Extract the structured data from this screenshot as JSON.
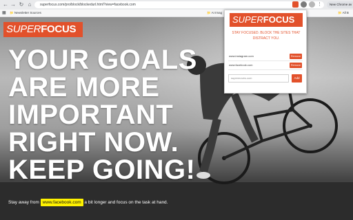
{
  "browser": {
    "url": "superfocus.com/pro/block/blockedurl.html?view=facebook.com",
    "new_chrome_label": "New Chrome av",
    "bookmarks": [
      "Newsletter Sources",
      "AI Imag",
      "All B"
    ]
  },
  "page": {
    "logo_super": "SUPER",
    "logo_focus": "FOCUS",
    "headline": [
      "YOUR GOALS",
      "ARE MORE",
      "IMPORTANT",
      "RIGHT NOW.",
      "KEEP GOING!"
    ],
    "subline_before": "Stay away from",
    "blocked_site": "www.facebook.com",
    "subline_after": "a bit longer and focus on the task at hand."
  },
  "popup": {
    "logo_super": "SUPER",
    "logo_focus": "FOCUS",
    "tagline": "STAY FOCUSED. BLOCK THE SITES THAT DISTRACT YOU.",
    "blocked_sites": [
      {
        "name": "www.instagram.com",
        "button": "Remove"
      },
      {
        "name": "www.facebook.com",
        "button": "Remove"
      }
    ],
    "input_placeholder": "supermoves.com",
    "add_label": "Add"
  },
  "colors": {
    "accent": "#e2512b",
    "highlight": "#fff200"
  }
}
